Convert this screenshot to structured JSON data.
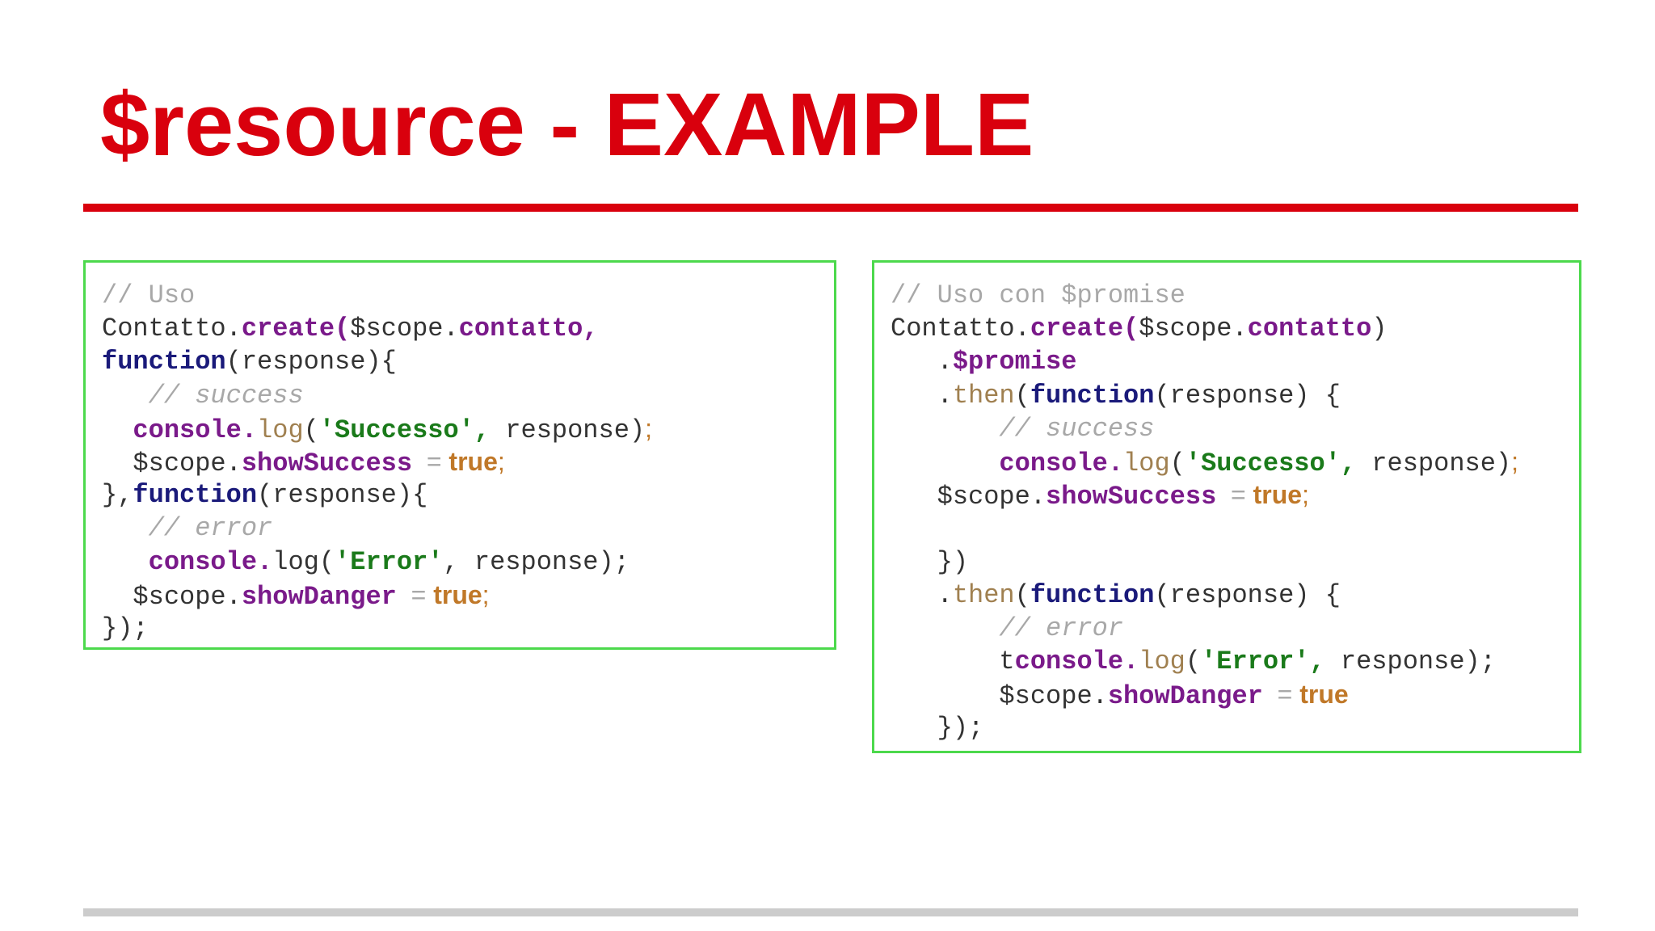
{
  "slide": {
    "title": "$resource - EXAMPLE",
    "colors": {
      "title": "#d9000d",
      "title_rule": "#d9000d",
      "box_border": "#4cd94c",
      "footer_rule": "#cccccc",
      "comment": "#a8a8a8",
      "member": "#7a1a8a",
      "keyword": "#1a1a7a",
      "string": "#1a7a1a",
      "method": "#a08050",
      "boolean": "#c07828"
    }
  },
  "code_left": {
    "lines": [
      [
        {
          "t": "// Uso",
          "k": "comment"
        }
      ],
      [
        {
          "t": "Contatto.",
          "k": "plain"
        },
        {
          "t": "create(",
          "k": "member"
        },
        {
          "t": "$scope.",
          "k": "plain"
        },
        {
          "t": "contatto,",
          "k": "member"
        }
      ],
      [
        {
          "t": "function",
          "k": "keyword"
        },
        {
          "t": "(response){",
          "k": "plain"
        }
      ],
      [
        {
          "t": "   ",
          "k": "plain"
        },
        {
          "t": "// success",
          "k": "comment-i"
        }
      ],
      [
        {
          "t": "  ",
          "k": "plain"
        },
        {
          "t": "console.",
          "k": "member"
        },
        {
          "t": "log",
          "k": "method"
        },
        {
          "t": "(",
          "k": "plain"
        },
        {
          "t": "'Successo',",
          "k": "string"
        },
        {
          "t": " response)",
          "k": "plain"
        },
        {
          "t": ";",
          "k": "semi"
        }
      ],
      [
        {
          "t": "  ",
          "k": "plain"
        },
        {
          "t": "$scope.",
          "k": "plain"
        },
        {
          "t": "showSuccess",
          "k": "member"
        },
        {
          "t": "  = ",
          "k": "op"
        },
        {
          "t": "true",
          "k": "bool"
        },
        {
          "t": ";",
          "k": "semi"
        }
      ],
      [
        {
          "t": "},",
          "k": "plain"
        },
        {
          "t": "function",
          "k": "keyword"
        },
        {
          "t": "(response){",
          "k": "plain"
        }
      ],
      [
        {
          "t": "   ",
          "k": "plain"
        },
        {
          "t": "// error",
          "k": "comment-i"
        }
      ],
      [
        {
          "t": "   ",
          "k": "plain"
        },
        {
          "t": "console.",
          "k": "member"
        },
        {
          "t": "log(",
          "k": "plain"
        },
        {
          "t": "'Error'",
          "k": "string"
        },
        {
          "t": ", response);",
          "k": "plain"
        }
      ],
      [
        {
          "t": "  ",
          "k": "plain"
        },
        {
          "t": "$scope.",
          "k": "plain"
        },
        {
          "t": "showDanger",
          "k": "member"
        },
        {
          "t": "  = ",
          "k": "op"
        },
        {
          "t": "true",
          "k": "bool"
        },
        {
          "t": ";",
          "k": "semi"
        }
      ],
      [
        {
          "t": "});",
          "k": "plain"
        }
      ]
    ]
  },
  "code_right": {
    "lines": [
      [
        {
          "t": "// Uso con $promise",
          "k": "comment"
        }
      ],
      [
        {
          "t": "Contatto.",
          "k": "plain"
        },
        {
          "t": "create(",
          "k": "member"
        },
        {
          "t": "$scope.",
          "k": "plain"
        },
        {
          "t": "contatto",
          "k": "member"
        },
        {
          "t": ")",
          "k": "plain"
        }
      ],
      [
        {
          "t": "   .",
          "k": "plain"
        },
        {
          "t": "$promise",
          "k": "member"
        }
      ],
      [
        {
          "t": "   .",
          "k": "plain"
        },
        {
          "t": "then",
          "k": "method"
        },
        {
          "t": "(",
          "k": "plain"
        },
        {
          "t": "function",
          "k": "keyword"
        },
        {
          "t": "(response) {",
          "k": "plain"
        }
      ],
      [
        {
          "t": "       ",
          "k": "plain"
        },
        {
          "t": "// success",
          "k": "comment-i"
        }
      ],
      [
        {
          "t": "       ",
          "k": "plain"
        },
        {
          "t": "console.",
          "k": "member"
        },
        {
          "t": "log",
          "k": "method"
        },
        {
          "t": "(",
          "k": "plain"
        },
        {
          "t": "'Successo',",
          "k": "string"
        },
        {
          "t": " response)",
          "k": "plain"
        },
        {
          "t": ";",
          "k": "semi"
        }
      ],
      [
        {
          "t": "  ",
          "k": "plain"
        },
        {
          "t": " $scope.",
          "k": "plain"
        },
        {
          "t": "showSuccess",
          "k": "member"
        },
        {
          "t": "  = ",
          "k": "op"
        },
        {
          "t": "true",
          "k": "bool"
        },
        {
          "t": ";",
          "k": "semi"
        }
      ],
      [
        {
          "t": "",
          "k": "plain"
        }
      ],
      [
        {
          "t": "   })",
          "k": "plain"
        }
      ],
      [
        {
          "t": "   .",
          "k": "plain"
        },
        {
          "t": "then",
          "k": "method"
        },
        {
          "t": "(",
          "k": "plain"
        },
        {
          "t": "function",
          "k": "keyword"
        },
        {
          "t": "(response) {",
          "k": "plain"
        }
      ],
      [
        {
          "t": "       ",
          "k": "plain"
        },
        {
          "t": "// error",
          "k": "comment-i"
        }
      ],
      [
        {
          "t": "       t",
          "k": "plain"
        },
        {
          "t": "console.",
          "k": "member"
        },
        {
          "t": "log",
          "k": "method"
        },
        {
          "t": "(",
          "k": "plain"
        },
        {
          "t": "'Error',",
          "k": "string"
        },
        {
          "t": " response);",
          "k": "plain"
        }
      ],
      [
        {
          "t": "      ",
          "k": "plain"
        },
        {
          "t": " $scope.",
          "k": "plain"
        },
        {
          "t": "showDanger",
          "k": "member"
        },
        {
          "t": "  = ",
          "k": "op"
        },
        {
          "t": "true",
          "k": "bool"
        }
      ],
      [
        {
          "t": "   });",
          "k": "plain"
        }
      ]
    ]
  }
}
